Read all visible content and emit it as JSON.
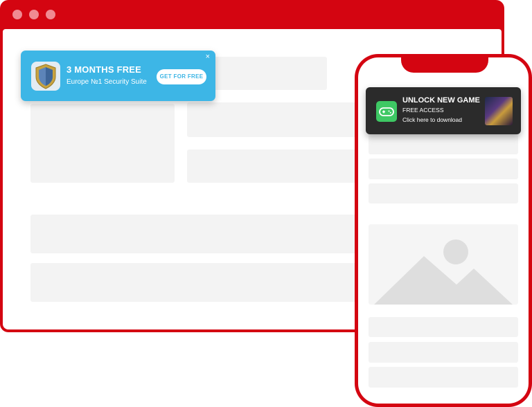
{
  "desktop_push": {
    "title": "3 MONTHS FREE",
    "subtitle": "Europe №1 Security Suite",
    "button_label": "GET FOR FREE",
    "close_symbol": "×",
    "icon": "shield-icon",
    "background_color": "#3db6e6"
  },
  "mobile_push": {
    "title": "UNLOCK NEW GAME",
    "subtitle": "FREE ACCESS",
    "cta_text": "Click here to download",
    "icon": "gamepad-icon",
    "thumbnail": "game-thumbnail",
    "background_color": "#2b2b2b"
  },
  "theme": {
    "frame_color": "#d40511",
    "placeholder_color": "#f3f3f3",
    "window_dot_color": "#f08a92"
  }
}
